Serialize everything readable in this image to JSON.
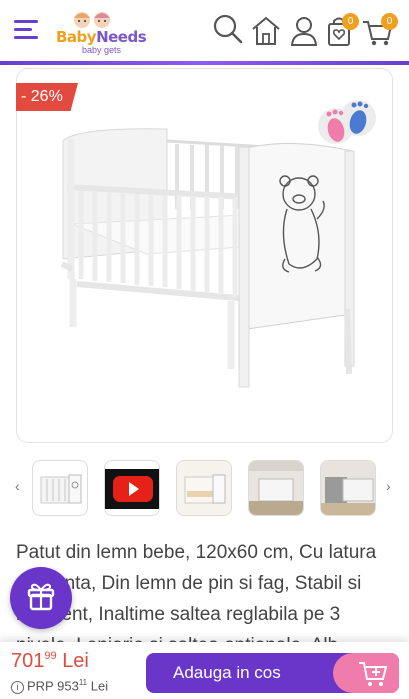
{
  "header": {
    "logo_main_a": "Baby",
    "logo_main_b": "Needs",
    "logo_sub": "baby gets",
    "wishlist_count": "0",
    "cart_count": "0"
  },
  "product": {
    "discount": "- 26%",
    "title": "Patut din lemn bebe, 120x60 cm, Cu latura culisanta, Din lemn de pin si fag, Stabil si rezistent, Inaltime saltea reglabila pe 3 nivele, Lenjerie si saltea optionale, Alb, Ursulet",
    "price_int": "701",
    "price_dec": "99",
    "currency": "Lei",
    "rrp_label": "PRP",
    "rrp_int": "953",
    "rrp_dec": "11",
    "rrp_currency": "Lei"
  },
  "actions": {
    "add_to_cart": "Adauga in cos"
  },
  "gallery": {
    "prev": "‹",
    "next": "›"
  },
  "colors": {
    "brand": "#6a35c9",
    "discount": "#e34a3f",
    "accent": "#f0a020",
    "pink": "#ef7cab"
  }
}
